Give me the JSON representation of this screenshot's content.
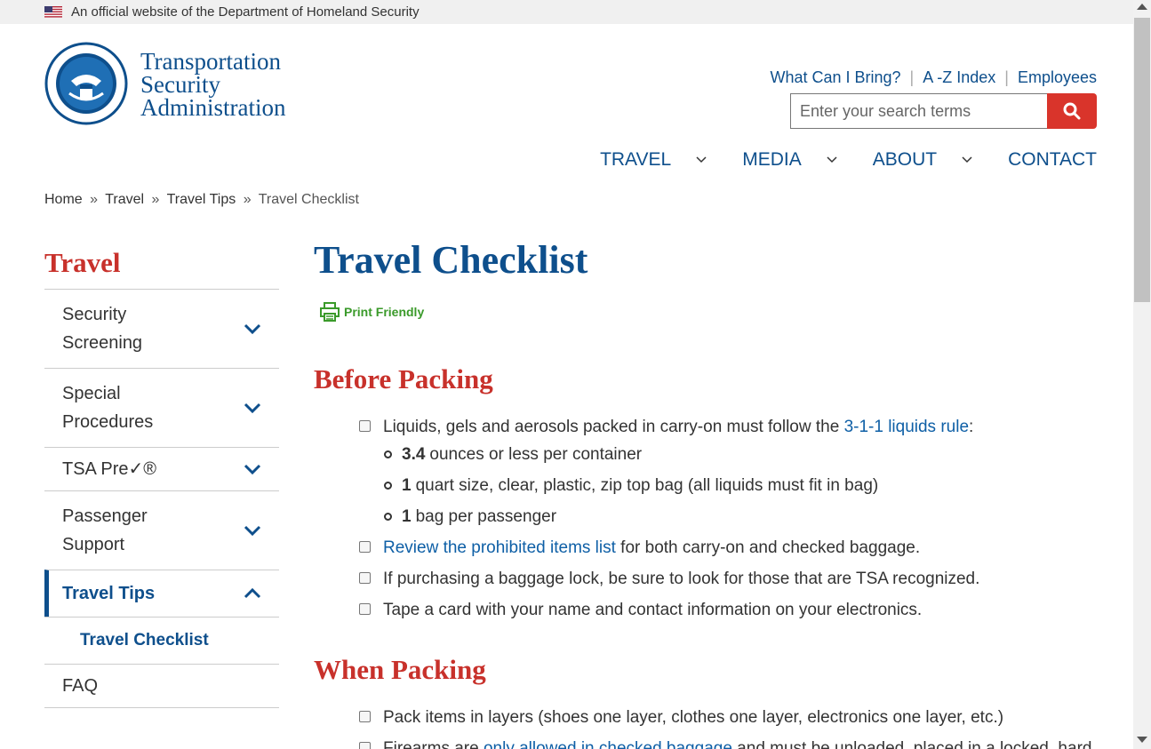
{
  "banner": {
    "text": "An official website of the Department of Homeland Security"
  },
  "header": {
    "logo_line1": "Transportation",
    "logo_line2": "Security",
    "logo_line3": "Administration",
    "util_links": [
      "What Can I Bring?",
      "A -Z Index",
      "Employees"
    ],
    "search_placeholder": "Enter your search terms",
    "nav": [
      "TRAVEL",
      "MEDIA",
      "ABOUT",
      "CONTACT"
    ]
  },
  "breadcrumb": {
    "items": [
      "Home",
      "Travel",
      "Travel Tips"
    ],
    "current": "Travel Checklist",
    "separator": "»"
  },
  "sidebar": {
    "title": "Travel",
    "items": [
      {
        "label": "Security Screening"
      },
      {
        "label": "Special Procedures"
      },
      {
        "label": "TSA Pre✓®"
      },
      {
        "label": "Passenger Support"
      },
      {
        "label": "Travel Tips"
      },
      {
        "label": "Travel Checklist"
      },
      {
        "label": "FAQ"
      }
    ]
  },
  "content": {
    "title": "Travel Checklist",
    "print_label": "Print Friendly",
    "section1": {
      "heading": "Before Packing",
      "item1_text": "Liquids, gels and aerosols packed in carry-on must follow the ",
      "item1_link": "3-1-1 liquids rule",
      "item1_suffix": ":",
      "sub": [
        {
          "num": "3.4",
          "text": "ounces or less per container"
        },
        {
          "num": "1",
          "text": "quart size, clear, plastic, zip top bag (all liquids must fit in bag)"
        },
        {
          "num": "1",
          "text": "bag per passenger"
        }
      ],
      "item2_link": "Review the prohibited items list",
      "item2_text": " for both carry-on and checked baggage.",
      "item3_text": "If purchasing a baggage lock, be sure to look for those that are TSA recognized.",
      "item4_text": "Tape a card with your name and contact information on your electronics."
    },
    "section2": {
      "heading": "When Packing",
      "item1_text": "Pack items in layers (shoes one layer, clothes one layer, electronics one layer, etc.)",
      "item2_text": "Firearms are ",
      "item2_link": "only allowed in checked baggage",
      "item2_suffix": " and must be unloaded, placed in a locked, hard"
    }
  },
  "colors": {
    "brand_blue": "#0e4f8c",
    "accent_red": "#c8312b",
    "search_red": "#d9342b",
    "print_green": "#3a9a2a"
  }
}
